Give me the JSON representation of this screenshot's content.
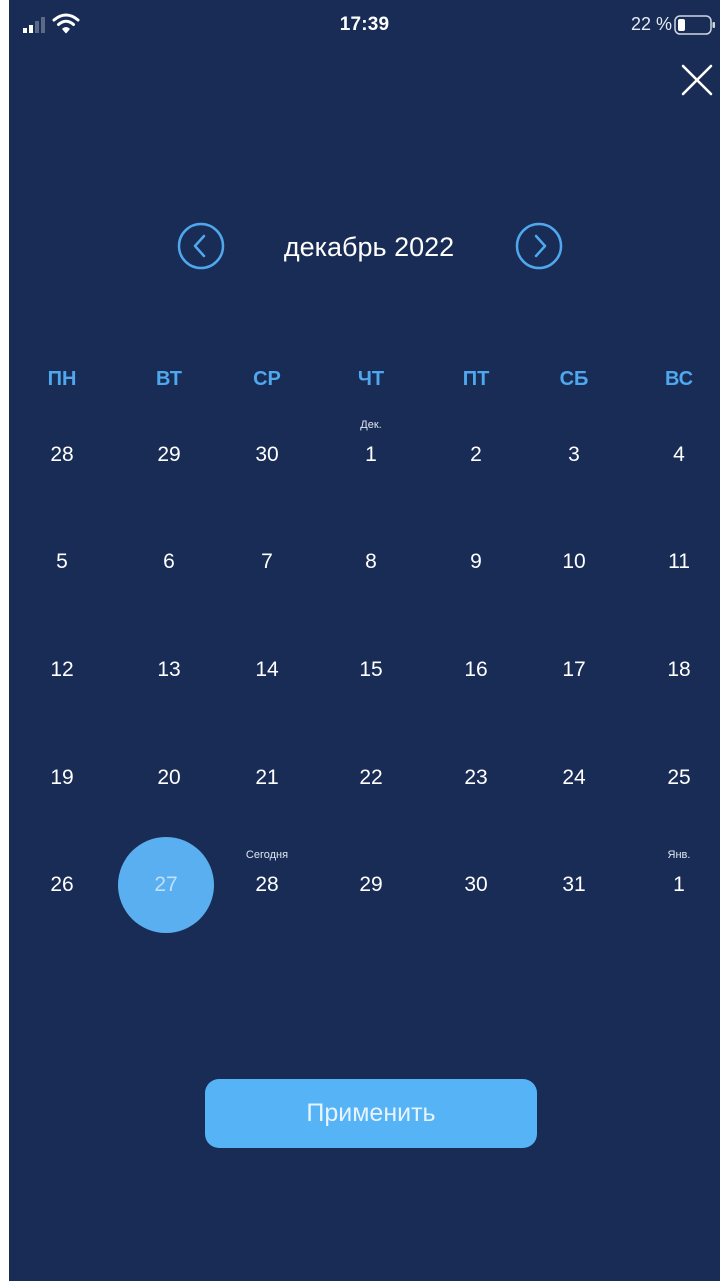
{
  "status_bar": {
    "time": "17:39",
    "battery": "22 %",
    "icons": [
      "signal-icon",
      "wifi-icon",
      "battery-icon"
    ]
  },
  "close_icon": "close-icon",
  "calendar": {
    "month_title": "декабрь 2022",
    "prev_icon": "chevron-left-circle-icon",
    "next_icon": "chevron-right-circle-icon",
    "weekdays": [
      "ПН",
      "ВТ",
      "СР",
      "ЧТ",
      "ПТ",
      "СБ",
      "ВС"
    ],
    "weeks": [
      [
        {
          "day": "28",
          "note": ""
        },
        {
          "day": "29",
          "note": ""
        },
        {
          "day": "30",
          "note": ""
        },
        {
          "day": "1",
          "note": "Дек."
        },
        {
          "day": "2",
          "note": ""
        },
        {
          "day": "3",
          "note": ""
        },
        {
          "day": "4",
          "note": ""
        }
      ],
      [
        {
          "day": "5",
          "note": ""
        },
        {
          "day": "6",
          "note": ""
        },
        {
          "day": "7",
          "note": ""
        },
        {
          "day": "8",
          "note": ""
        },
        {
          "day": "9",
          "note": ""
        },
        {
          "day": "10",
          "note": ""
        },
        {
          "day": "11",
          "note": ""
        }
      ],
      [
        {
          "day": "12",
          "note": ""
        },
        {
          "day": "13",
          "note": ""
        },
        {
          "day": "14",
          "note": ""
        },
        {
          "day": "15",
          "note": ""
        },
        {
          "day": "16",
          "note": ""
        },
        {
          "day": "17",
          "note": ""
        },
        {
          "day": "18",
          "note": ""
        }
      ],
      [
        {
          "day": "19",
          "note": ""
        },
        {
          "day": "20",
          "note": ""
        },
        {
          "day": "21",
          "note": ""
        },
        {
          "day": "22",
          "note": ""
        },
        {
          "day": "23",
          "note": ""
        },
        {
          "day": "24",
          "note": ""
        },
        {
          "day": "25",
          "note": ""
        }
      ],
      [
        {
          "day": "26",
          "note": ""
        },
        {
          "day": "27",
          "note": "",
          "selected": true
        },
        {
          "day": "28",
          "note": "Сегодня"
        },
        {
          "day": "29",
          "note": ""
        },
        {
          "day": "30",
          "note": ""
        },
        {
          "day": "31",
          "note": ""
        },
        {
          "day": "1",
          "note": "Янв."
        }
      ]
    ]
  },
  "apply_button": {
    "label": "Применить"
  },
  "colors": {
    "background": "#192c56",
    "accent": "#55b3f6",
    "weekday": "#4fa8ee",
    "text": "#ffffff"
  }
}
